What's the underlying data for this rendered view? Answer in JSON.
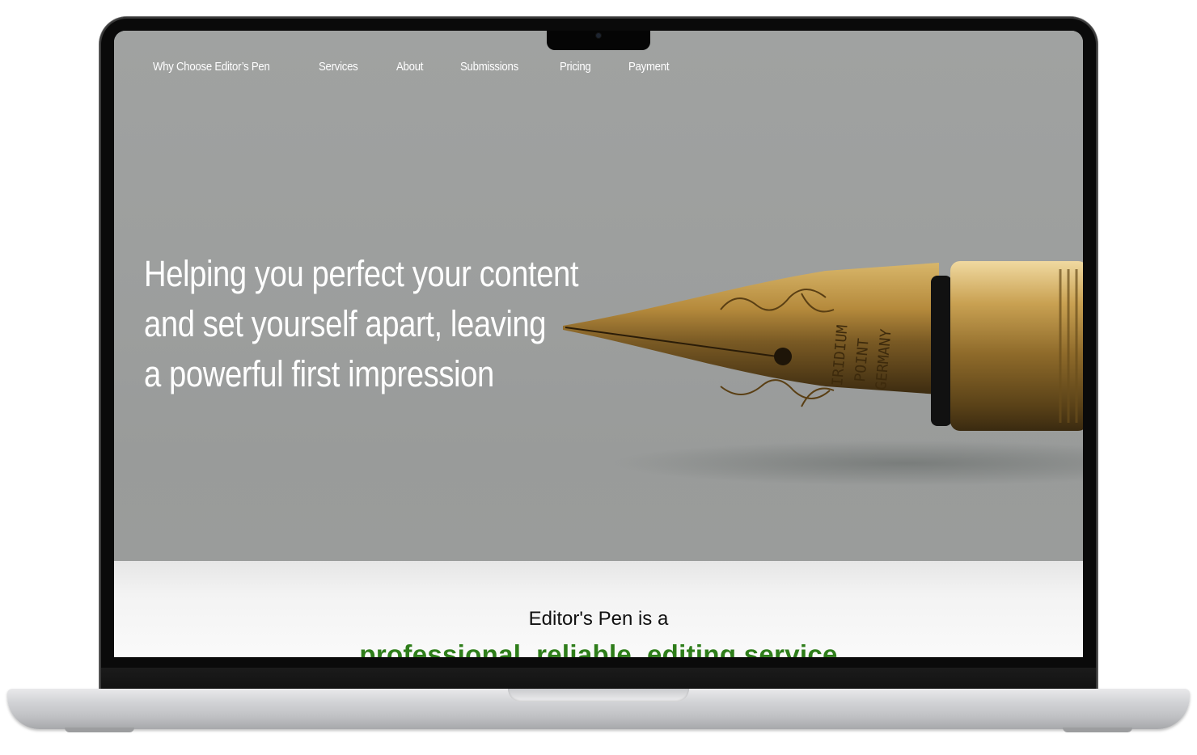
{
  "nav": {
    "items": [
      {
        "label": "Why Choose Editor’s Pen"
      },
      {
        "label": "Services"
      },
      {
        "label": "About"
      },
      {
        "label": "Submissions"
      },
      {
        "label": "Pricing"
      },
      {
        "label": "Payment"
      }
    ]
  },
  "hero": {
    "headline_lines": [
      "Helping you perfect your content",
      "and set yourself apart, leaving",
      "a powerful first impression"
    ],
    "pen_engraving": [
      "IRIDIUM",
      "POINT",
      "GERMANY"
    ]
  },
  "intro": {
    "line1": "Editor's Pen is a",
    "line2": "professional, reliable, editing service"
  },
  "colors": {
    "accent_green": "#2e7d1a",
    "hero_bg": "#9d9f9e"
  }
}
